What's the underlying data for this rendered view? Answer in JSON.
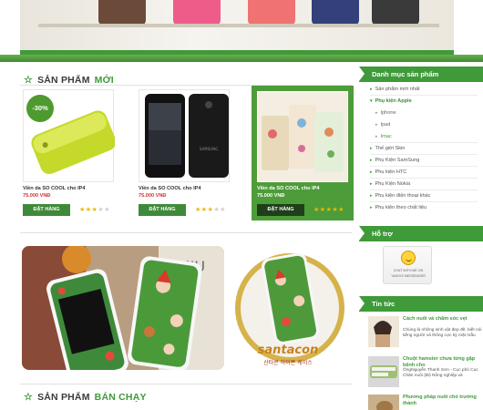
{
  "section_new": {
    "prefix": "SẢN PHẨM",
    "accent": "MỚI"
  },
  "section_best": {
    "prefix": "SẢN PHẨM",
    "accent": "BÁN CHẠY"
  },
  "products": [
    {
      "name": "Viền da SO COOL cho IP4",
      "price": "75.000 VNĐ",
      "order_label": "ĐẶT HÀNG",
      "rating": 3,
      "badge": "-30%"
    },
    {
      "name": "Viền da SO COOL cho IP4",
      "price": "75.000 VNĐ",
      "order_label": "ĐẶT HÀNG",
      "rating": 3
    },
    {
      "name": "Viền da SO COOL cho IP4",
      "price": "75.000 VNĐ",
      "order_label": "ĐẶT HÀNG",
      "rating": 5
    }
  ],
  "sidebar": {
    "categories_title": "Danh mục sản phẩm",
    "categories": [
      {
        "label": "Sản phẩm mới nhất",
        "level": 0
      },
      {
        "label": "Phụ kiện Apple",
        "level": 0,
        "open": true
      },
      {
        "label": "Iphone",
        "level": 1
      },
      {
        "label": "Ipad",
        "level": 1
      },
      {
        "label": "Imac",
        "level": 1,
        "current": true
      },
      {
        "label": "Thế giới Skin",
        "level": 0
      },
      {
        "label": "Phụ Kiện SamSung",
        "level": 0
      },
      {
        "label": "Phụ kiện HTC",
        "level": 0
      },
      {
        "label": "Phụ Kiện Nokia",
        "level": 0
      },
      {
        "label": "Phụ kiện điện thoại khác",
        "level": 0
      },
      {
        "label": "Phụ kiện theo chất liệu",
        "level": 0
      }
    ],
    "support_title": "Hỗ trợ",
    "support_line1": "CHAT WITH ME ON",
    "support_line2": "YAHOO! MESSENGER",
    "news_title": "Tin tức",
    "news": [
      {
        "title": "Cách nuôi và chăm sóc vẹt",
        "excerpt": "Chúng là những sinh vật đẹp đẽ, biết nói tiếng người và thông cực kỳ mặt mẫu"
      },
      {
        "title": "Chuột hamster chưa từng gặp bệnh cho",
        "excerpt": "ÔngNguyễn Thanh Sơn - Cục phó Cục Chăn nuôi (Bộ Nông nghiệp và"
      },
      {
        "title": "Phương pháp nuôi chó trường thành",
        "excerpt": ""
      }
    ]
  },
  "colors": {
    "brand_green": "#3f9a3a",
    "price_red": "#d23333",
    "star": "#f1b500"
  }
}
